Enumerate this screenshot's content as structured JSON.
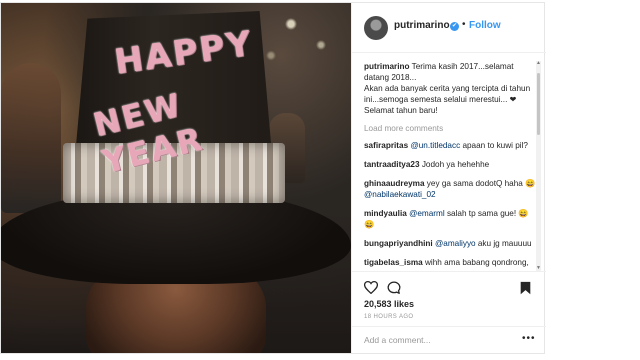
{
  "post": {
    "username": "putrimarino",
    "verified_badge": "✔",
    "separator": "•",
    "follow_label": "Follow",
    "hat_text_line1": "HAPPY",
    "hat_text_line2": "NEW YEAR",
    "caption": {
      "user": "putrimarino",
      "line1": "Terima kasih 2017...selamat datang 2018...",
      "line2": "Akan ada banyak cerita yang tercipta di tahun ini...semoga semesta selalui merestui... ❤",
      "line3": "Selamat tahun baru!"
    },
    "load_more_label": "Load more comments",
    "comments": [
      {
        "user": "safirapritas",
        "mention": "@un.titledacc",
        "text": " apaan to kuwi pil?"
      },
      {
        "user": "tantraaditya23",
        "mention": "",
        "text": "Jodoh ya hehehhe"
      },
      {
        "user": "ghinaaudreyma",
        "mention": "@nabilaekawati_02",
        "text": "yey ga sama dodotQ haha 😄 "
      },
      {
        "user": "mindyaulia",
        "mention": "@emarml",
        "text": " salah tp sama gue! 😄😄"
      },
      {
        "user": "bungapriyandhini",
        "mention": "@amaliyyo",
        "text": " aku jg mauuuu"
      },
      {
        "user": "tigabelas_isma",
        "mention": "",
        "text": "wihh ama babang qondrong, dodot nya kemana mbaaaaa"
      }
    ],
    "likes": "20,583 likes",
    "time": "18 HOURS AGO",
    "add_comment_placeholder": "Add a comment...",
    "more_options": "•••"
  },
  "icons": {
    "heart": "heart-icon",
    "comment": "comment-icon",
    "bookmark": "bookmark-icon",
    "verified": "verified-badge-icon"
  },
  "colors": {
    "link_blue": "#3897f0",
    "text": "#262626",
    "muted": "#999999"
  }
}
